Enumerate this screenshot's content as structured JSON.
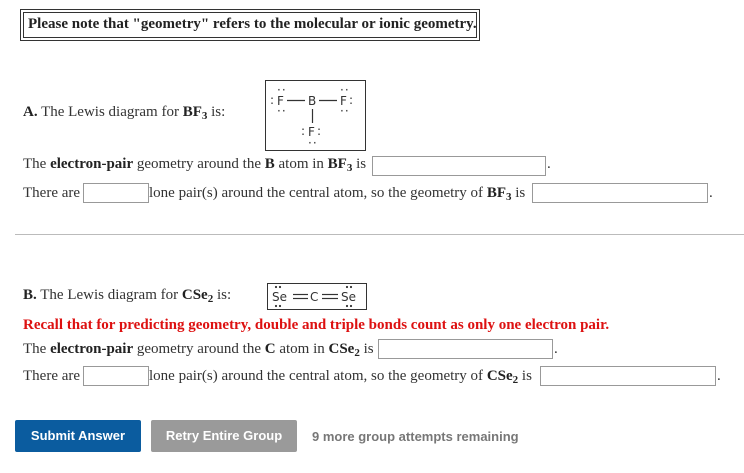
{
  "note": {
    "text": "Please note that \"geometry\" refers to the molecular or ionic geometry."
  },
  "partA": {
    "intro_prefix": "A.",
    "intro_text": " The Lewis diagram for ",
    "formula_main": "BF",
    "formula_sub": "3",
    "intro_suffix": " is:",
    "lewis": {
      "left_atom": "F",
      "center_atom": "B",
      "right_atom": "F",
      "bottom_atom": "F",
      "lone_pair": ":",
      "dots": "··"
    },
    "q1": {
      "text1": "The ",
      "bold1": "electron-pair",
      "text2": " geometry around the ",
      "bold2": "B",
      "text3": " atom in ",
      "formula_main": "BF",
      "formula_sub": "3",
      "text4": " is ",
      "value": "",
      "end": "."
    },
    "q2": {
      "text1": "There are ",
      "value1": "",
      "text2": " lone pair(s) around the central atom, so the geometry of ",
      "formula_main": "BF",
      "formula_sub": "3",
      "text3": " is ",
      "value2": "",
      "end": "."
    }
  },
  "partB": {
    "intro_prefix": "B.",
    "intro_text": " The Lewis diagram for ",
    "formula_main": "CSe",
    "formula_sub": "2",
    "intro_suffix": " is:",
    "lewis": {
      "left_atom": "Se",
      "center_atom": "C",
      "right_atom": "Se"
    },
    "recall": "Recall that for predicting geometry, double and triple bonds count as only one electron pair.",
    "q1": {
      "text1": "The ",
      "bold1": "electron-pair",
      "text2": " geometry around the ",
      "bold2": "C",
      "text3": " atom in ",
      "formula_main": "CSe",
      "formula_sub": "2",
      "text4": " is ",
      "value": "",
      "end": "."
    },
    "q2": {
      "text1": "There are ",
      "value1": "",
      "text2": " lone pair(s) around the central atom, so the geometry of ",
      "formula_main": "CSe",
      "formula_sub": "2",
      "text3": " is ",
      "value2": "",
      "end": "."
    }
  },
  "buttons": {
    "submit": "Submit Answer",
    "retry": "Retry Entire Group",
    "attempts": "9 more group attempts remaining"
  },
  "colors": {
    "submit_bg": "#0b5c9f",
    "retry_bg": "#9a9a9a",
    "recall_text": "#dd1111"
  }
}
